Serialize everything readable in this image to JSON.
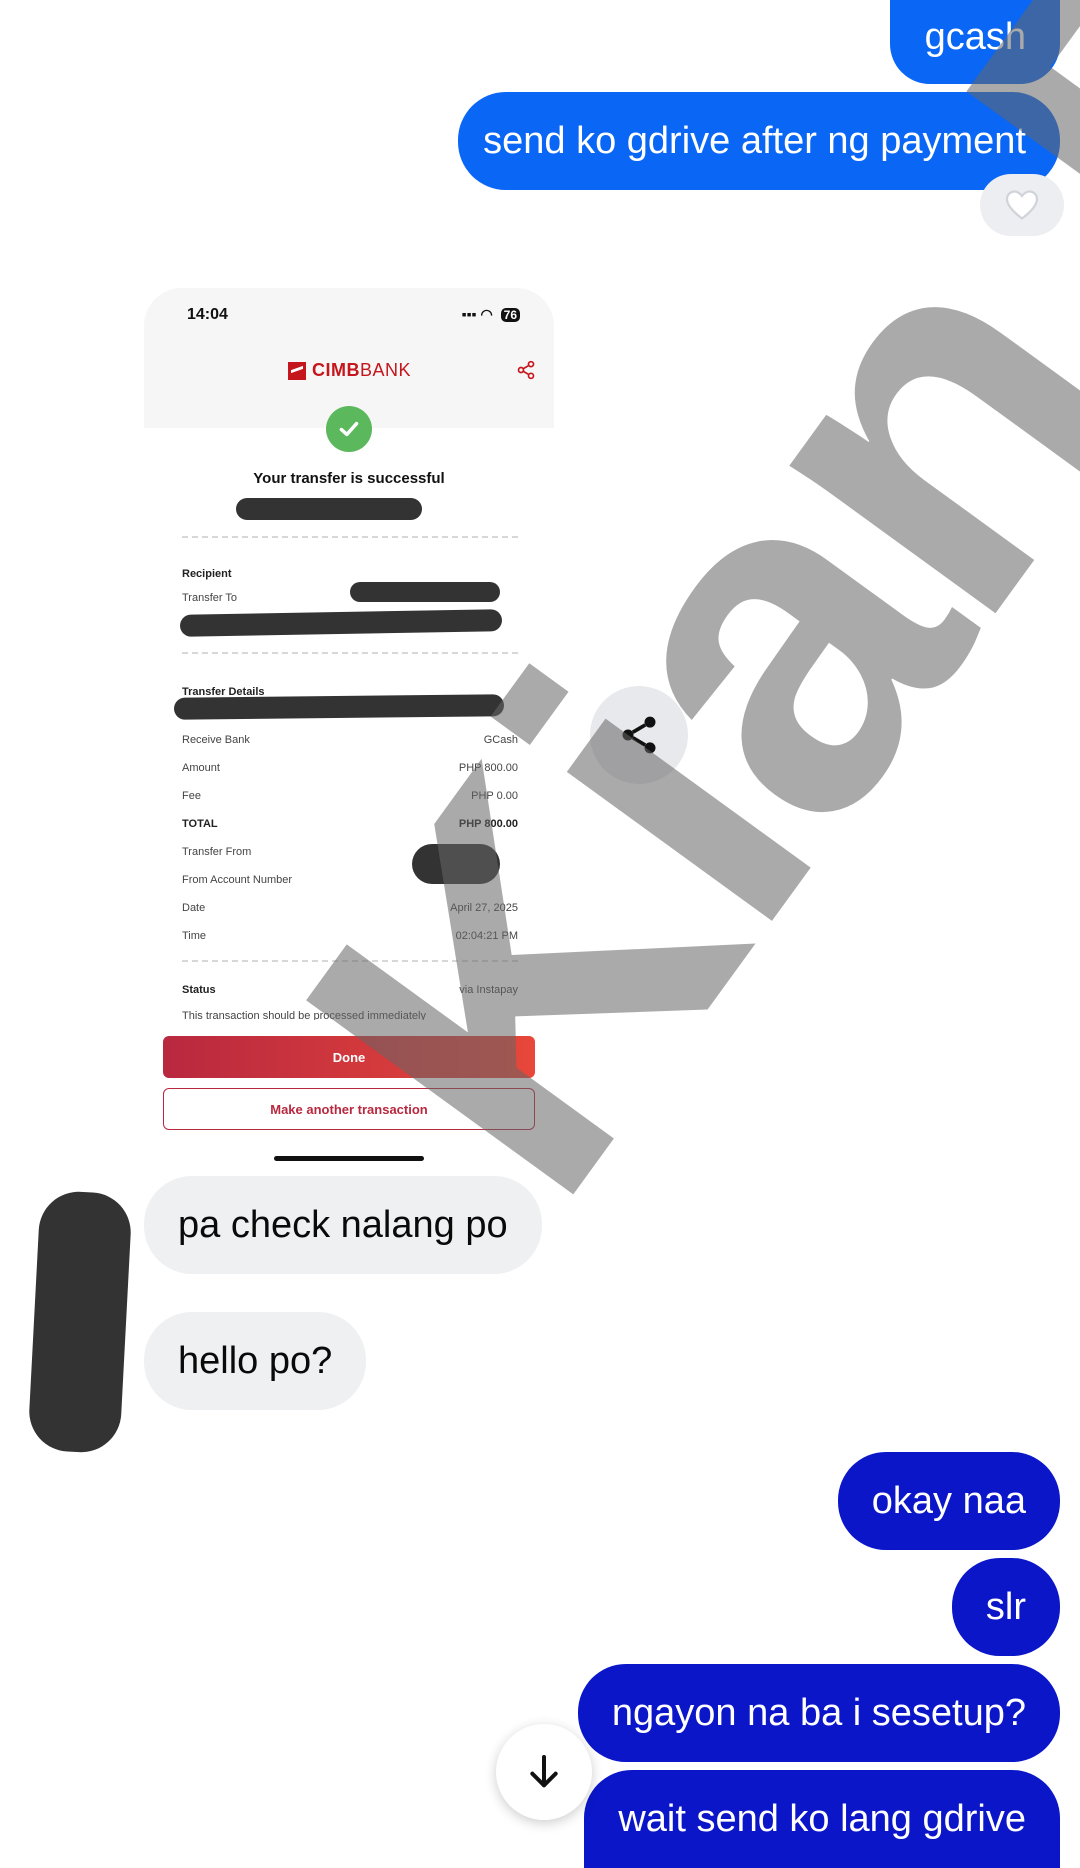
{
  "colors": {
    "outgoing_blue": "#0a66f5",
    "outgoing_deep": "#0b16c9",
    "incoming_bg": "#eff0f2",
    "cimb_red": "#c4161c",
    "success_green": "#5cb85c"
  },
  "messages_out_top": [
    {
      "text": "gcash"
    },
    {
      "text": "send ko gdrive after ng payment"
    }
  ],
  "reaction": {
    "icon": "heart-icon"
  },
  "receipt": {
    "status_bar": {
      "time": "14:04",
      "battery": "76"
    },
    "bank_name_bold": "CIMB",
    "bank_name_rest": "BANK",
    "headline": "Your transfer is successful",
    "recipient_title": "Recipient",
    "transfer_to_label": "Transfer To",
    "transfer_details_title": "Transfer Details",
    "rows": [
      {
        "label": "Receive Bank",
        "value": "GCash"
      },
      {
        "label": "Amount",
        "value": "PHP 800.00"
      },
      {
        "label": "Fee",
        "value": "PHP 0.00"
      },
      {
        "label": "TOTAL",
        "value": "PHP 800.00"
      },
      {
        "label": "Transfer From",
        "value": ""
      },
      {
        "label": "From Account Number",
        "value": ""
      },
      {
        "label": "Date",
        "value": "April 27, 2025"
      },
      {
        "label": "Time",
        "value": "02:04:21 PM"
      }
    ],
    "status_label": "Status",
    "status_value": "via Instapay",
    "status_note": "This transaction should be processed immediately",
    "done_label": "Done",
    "another_label": "Make another transaction"
  },
  "messages_in": [
    {
      "text": "pa check nalang po"
    },
    {
      "text": "hello po?"
    }
  ],
  "messages_out_bottom": [
    {
      "text": "okay naa"
    },
    {
      "text": "slr"
    },
    {
      "text": "ngayon na ba i sesetup?"
    },
    {
      "text": "wait  send ko lang gdrive"
    }
  ],
  "watermark": "Kian Dev"
}
